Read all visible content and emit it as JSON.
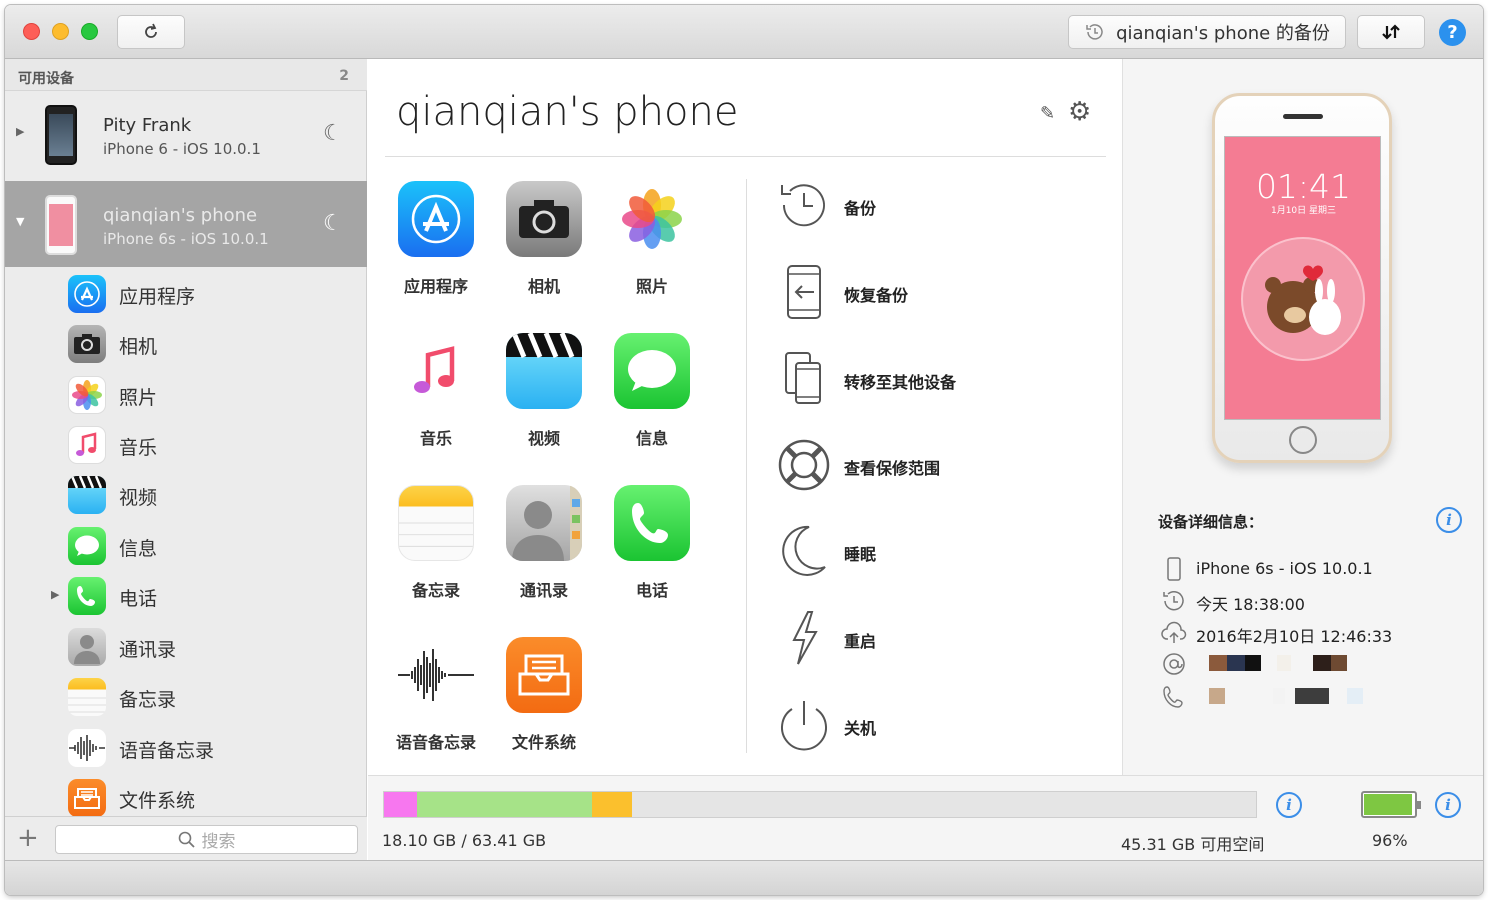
{
  "titlebar": {
    "backup_label": "qianqian's phone 的备份",
    "sync_icon": "sync-arrows-icon",
    "help_label": "?",
    "colors": {
      "close": "#fd5e57",
      "minimize": "#fdbc2e",
      "zoom": "#28c840"
    }
  },
  "sidebar": {
    "header": "可用设备",
    "count": "2",
    "devices": [
      {
        "name": "Pity Frank",
        "sub": "iPhone 6 - iOS 10.0.1"
      },
      {
        "name": "qianqian's phone",
        "sub": "iPhone 6s - iOS 10.0.1"
      }
    ],
    "items": [
      {
        "label": "应用程序",
        "icon": "app-store-icon"
      },
      {
        "label": "相机",
        "icon": "camera-icon"
      },
      {
        "label": "照片",
        "icon": "photos-icon"
      },
      {
        "label": "音乐",
        "icon": "music-icon"
      },
      {
        "label": "视频",
        "icon": "video-icon"
      },
      {
        "label": "信息",
        "icon": "messages-icon"
      },
      {
        "label": "电话",
        "icon": "phone-icon"
      },
      {
        "label": "通讯录",
        "icon": "contacts-icon"
      },
      {
        "label": "备忘录",
        "icon": "notes-icon"
      },
      {
        "label": "语音备忘录",
        "icon": "voice-memo-icon"
      },
      {
        "label": "文件系统",
        "icon": "file-system-icon"
      }
    ],
    "search_placeholder": "搜索"
  },
  "main": {
    "title": "qianqian's phone",
    "apps": [
      {
        "label": "应用程序"
      },
      {
        "label": "相机"
      },
      {
        "label": "照片"
      },
      {
        "label": "音乐"
      },
      {
        "label": "视频"
      },
      {
        "label": "信息"
      },
      {
        "label": "备忘录"
      },
      {
        "label": "通讯录"
      },
      {
        "label": "电话"
      },
      {
        "label": "语音备忘录"
      },
      {
        "label": "文件系统"
      }
    ],
    "actions": [
      {
        "label": "备份",
        "icon": "backup-clock-icon"
      },
      {
        "label": "恢复备份",
        "icon": "restore-backup-icon"
      },
      {
        "label": "转移至其他设备",
        "icon": "transfer-device-icon"
      },
      {
        "label": "查看保修范围",
        "icon": "lifebuoy-icon"
      },
      {
        "label": "睡眠",
        "icon": "moon-icon"
      },
      {
        "label": "重启",
        "icon": "lightning-icon"
      },
      {
        "label": "关机",
        "icon": "power-icon"
      }
    ]
  },
  "details": {
    "title": "设备详细信息：",
    "phone_time": "01:41",
    "phone_date": "1月10日 星期三",
    "rows": [
      {
        "icon": "device-icon",
        "text": "iPhone 6s - iOS 10.0.1"
      },
      {
        "icon": "history-clock-icon",
        "text": "今天 18:38:00"
      },
      {
        "icon": "cloud-upload-icon",
        "text": "2016年2月10日 12:46:33"
      },
      {
        "icon": "at-sign-icon",
        "text": ""
      },
      {
        "icon": "phone-handset-icon",
        "text": ""
      }
    ]
  },
  "storage": {
    "used_text": "18.10 GB / 63.41 GB",
    "free_text": "45.31 GB 可用空间",
    "battery_text": "96%",
    "battery_level": 0.96,
    "segments": [
      {
        "color": "#f777ef",
        "fraction": 0.038
      },
      {
        "color": "#a6e388",
        "fraction": 0.2
      },
      {
        "color": "#fbc02d",
        "fraction": 0.047
      }
    ]
  }
}
